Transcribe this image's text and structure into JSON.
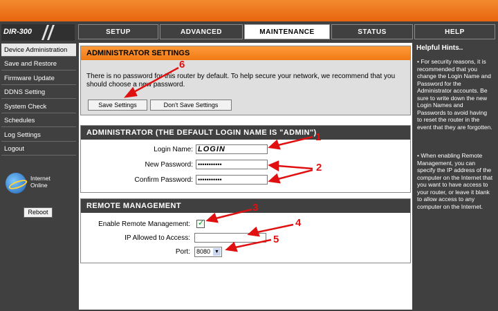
{
  "logo": {
    "model": "DIR-300"
  },
  "tabs": [
    {
      "label": "SETUP",
      "active": false
    },
    {
      "label": "ADVANCED",
      "active": false
    },
    {
      "label": "MAINTENANCE",
      "active": true
    },
    {
      "label": "STATUS",
      "active": false
    },
    {
      "label": "HELP",
      "active": false
    }
  ],
  "sidebar": {
    "items": [
      {
        "label": "Device Administration",
        "active": true
      },
      {
        "label": "Save and Restore",
        "active": false
      },
      {
        "label": "Firmware Update",
        "active": false
      },
      {
        "label": "DDNS Setting",
        "active": false
      },
      {
        "label": "System Check",
        "active": false
      },
      {
        "label": "Schedules",
        "active": false
      },
      {
        "label": "Log Settings",
        "active": false
      },
      {
        "label": "Logout",
        "active": false
      }
    ],
    "internet_status": {
      "line1": "Internet",
      "line2": "Online"
    },
    "reboot_label": "Reboot"
  },
  "admin_settings": {
    "title": "ADMINISTRATOR SETTINGS",
    "description": "There is no password for this router by default. To help secure your network, we recommend that you should choose a new password.",
    "save_label": "Save Settings",
    "dont_save_label": "Don't Save Settings"
  },
  "administrator": {
    "title": "ADMINISTRATOR (THE DEFAULT LOGIN NAME IS \"ADMIN\")",
    "login_label": "Login Name:",
    "login_value": "LOGIN",
    "new_password_label": "New Password:",
    "new_password_value": "•••••••••••",
    "confirm_password_label": "Confirm Password:",
    "confirm_password_value": "•••••••••••"
  },
  "remote": {
    "title": "REMOTE MANAGEMENT",
    "enable_label": "Enable Remote Management:",
    "enabled": true,
    "ip_label": "IP Allowed to Access:",
    "ip_value": "",
    "port_label": "Port:",
    "port_value": "8080"
  },
  "hints": {
    "title": "Helpful Hints..",
    "p1": "• For security reasons, it is recommended that you change the Login Name and Password for the Administrator accounts. Be sure to write down the new Login Names and Passwords to avoid having to reset the router in the event that they are forgotten.",
    "p2": "• When enabling Remote Management, you can specify the IP address of the computer on the Internet that you want to have access to your router, or leave it blank to allow access to any computer on the Internet."
  },
  "annotations": [
    "1",
    "2",
    "3",
    "4",
    "5",
    "6"
  ],
  "colors": {
    "annotation": "#e01010",
    "header_orange": "#f07a14",
    "frame": "#404040"
  }
}
